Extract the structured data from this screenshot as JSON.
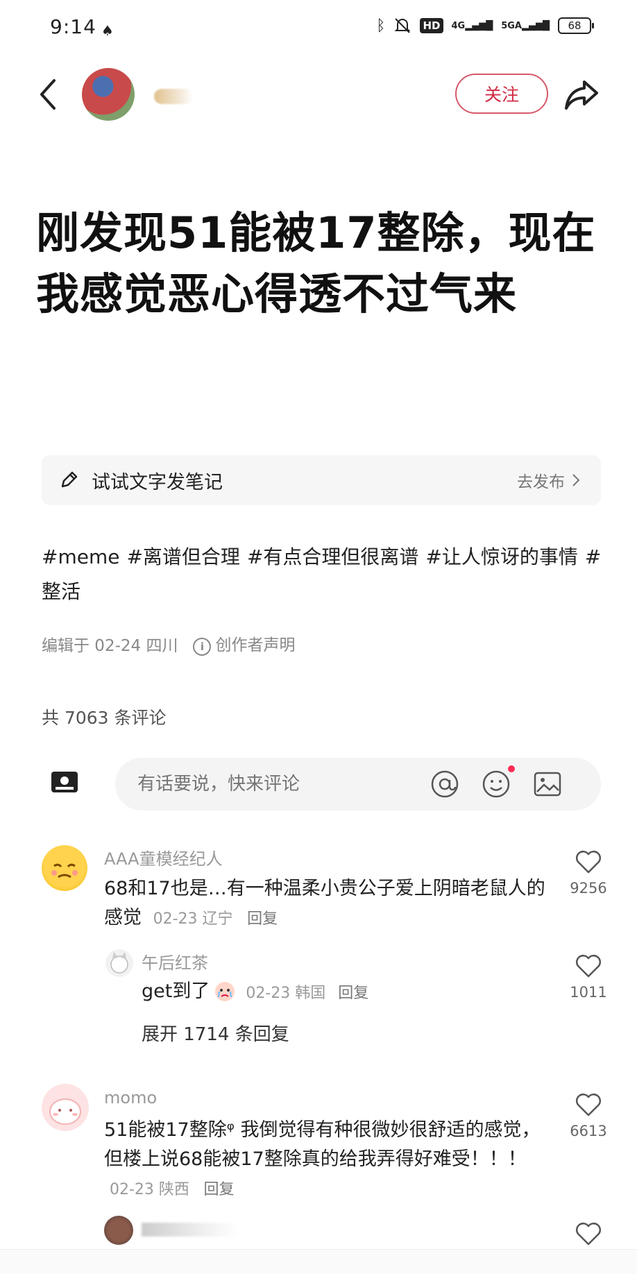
{
  "status": {
    "time": "9:14",
    "hd": "HD",
    "net1": "4G",
    "net2": "5GA",
    "battery": "68"
  },
  "header": {
    "follow_label": "关注"
  },
  "post": {
    "title": "刚发现51能被17整除，现在我感觉恶心得透不过气来",
    "tags": [
      "#meme",
      "#离谱但合理",
      "#有点合理但很离谱",
      "#让人惊讶的事情",
      "#整活"
    ],
    "edited": "编辑于 02-24 四川",
    "disclaimer": "创作者声明",
    "comment_count": "共 7063 条评论"
  },
  "try_card": {
    "text": "试试文字发笔记",
    "action": "去发布"
  },
  "comment_input": {
    "placeholder": "有话要说，快来评论"
  },
  "comments": [
    {
      "name": "AAA童模经纪人",
      "text": "68和17也是…有一种温柔小贵公子爱上阴暗老鼠人的感觉",
      "date": "02-23 辽宁",
      "reply": "回复",
      "likes": "9256"
    },
    {
      "name": "momo",
      "text": "51能被17整除ᵠ 我倒觉得有种很微妙很舒适的感觉，但楼上说68能被17整除真的给我弄得好难受！！！",
      "date": "02-23 陕西",
      "reply": "回复",
      "likes": "6613"
    }
  ],
  "sub_reply": {
    "name": "午后红茶",
    "text": "get到了",
    "date": "02-23 韩国",
    "reply": "回复",
    "likes": "1011"
  },
  "expand_label": "展开 1714 条回复"
}
